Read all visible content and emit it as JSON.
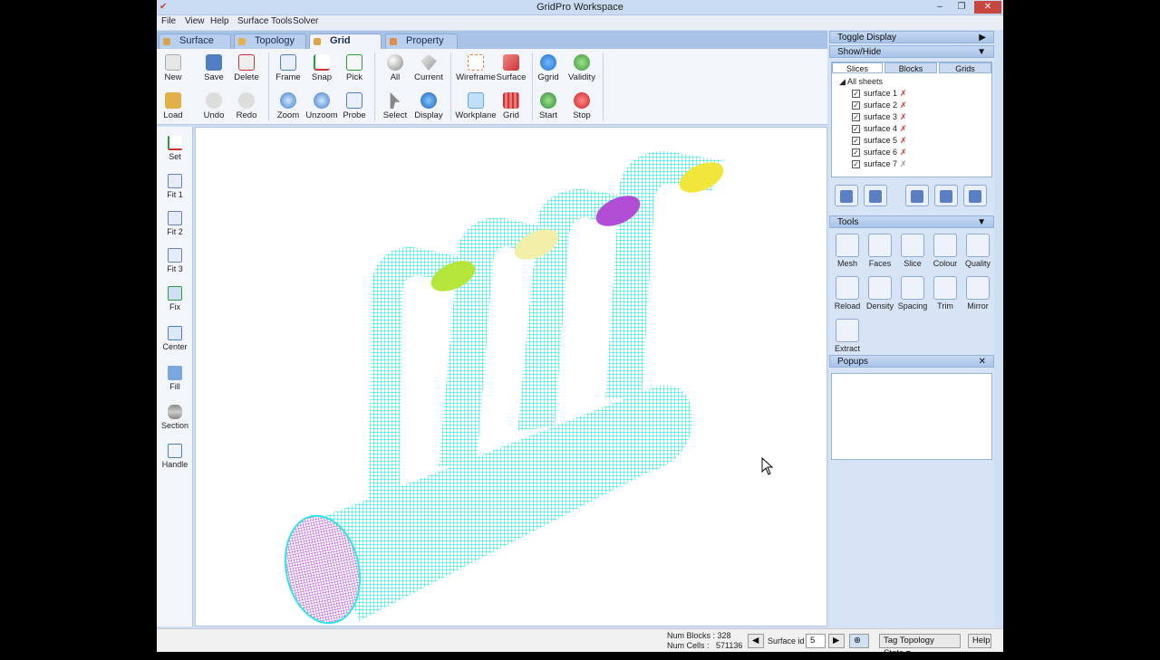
{
  "app": {
    "title": "GridPro Workspace"
  },
  "menu": [
    "File",
    "View",
    "Help",
    "Surface Tools",
    "Solver"
  ],
  "tabs": [
    {
      "label": "Surface"
    },
    {
      "label": "Topology"
    },
    {
      "label": "Grid"
    },
    {
      "label": "Property"
    }
  ],
  "toolbar": {
    "row1": [
      "New",
      "Save",
      "Delete",
      "Frame",
      "Snap",
      "Pick",
      "All",
      "Current",
      "Wireframe",
      "Surface",
      "Ggrid",
      "Validity"
    ],
    "row2": [
      "Load",
      "Undo",
      "Redo",
      "Zoom",
      "Unzoom",
      "Probe",
      "Select",
      "Display",
      "Workplane",
      "Grid",
      "Start",
      "Stop"
    ]
  },
  "lefttools": [
    "Set",
    "Fit 1",
    "Fit 2",
    "Fit 3",
    "Fix",
    "Center",
    "Fill",
    "Section",
    "Handle"
  ],
  "rightpanel": {
    "toggle_display": "Toggle Display",
    "show_hide": "Show/Hide",
    "subtabs": [
      "Slices",
      "Blocks",
      "Grids"
    ],
    "tree_root": "All sheets",
    "surfaces": [
      "surface 1",
      "surface 2",
      "surface 3",
      "surface 4",
      "surface 5",
      "surface 6",
      "surface 7"
    ],
    "tools_title": "Tools",
    "tools_row1": [
      "Mesh",
      "Faces",
      "Slice",
      "Colour",
      "Quality"
    ],
    "tools_row2": [
      "Reload",
      "Density",
      "Spacing",
      "Trim",
      "Mirror"
    ],
    "tools_row3": [
      "Extract"
    ],
    "popups_title": "Popups"
  },
  "status": {
    "num_blocks": "Num Blocks : 328",
    "num_cells_label": "Num Cells :",
    "num_cells_value": "571136",
    "surface_id_label": "Surface id :",
    "surface_id_value": "5",
    "tag_state": "Tag Topology State",
    "help": "Help"
  },
  "colors": {
    "mesh": "#2ee6e6",
    "inlet_violet": "#b24ed6",
    "yellow": "#f2e63a",
    "lime": "#b7e63a",
    "pale": "#f1efa8"
  }
}
